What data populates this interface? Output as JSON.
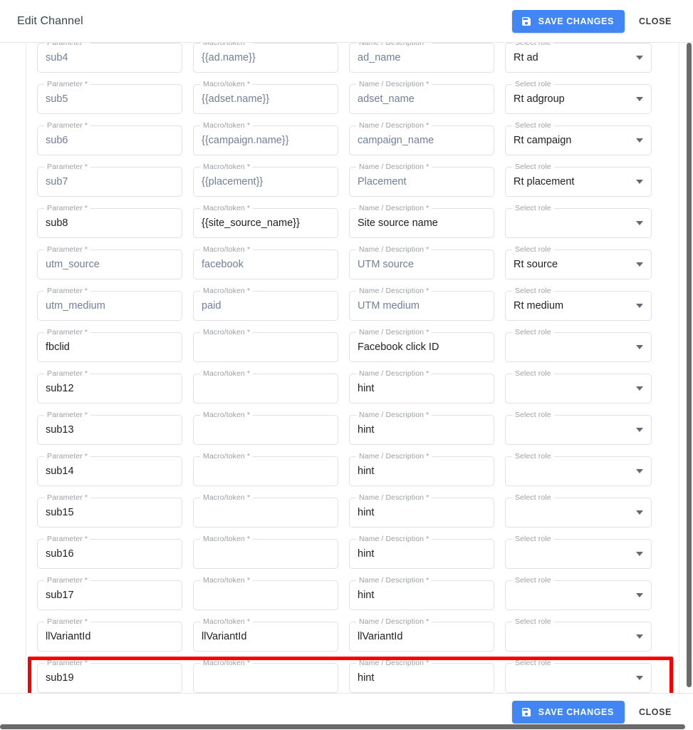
{
  "header": {
    "title": "Edit Channel",
    "save_label": "SAVE CHANGES",
    "close_label": "CLOSE",
    "save_icon": "save-floppy-icon",
    "accent_color": "#4285f4"
  },
  "footer": {
    "save_label": "SAVE CHANGES",
    "close_label": "CLOSE",
    "save_icon": "save-floppy-icon"
  },
  "columns": {
    "parameter": "Parameter *",
    "macro": "Macro/token *",
    "name": "Name / Description *",
    "role": "Select role"
  },
  "annotation": {
    "color": "#f80000",
    "target_row_index": 15
  },
  "rows": [
    {
      "parameter": "sub4",
      "parameter_filled": false,
      "macro": "{{ad.name}}",
      "macro_filled": false,
      "name": "ad_name",
      "name_filled": false,
      "role": "Rt ad",
      "role_filled": true
    },
    {
      "parameter": "sub5",
      "parameter_filled": false,
      "macro": "{{adset.name}}",
      "macro_filled": false,
      "name": "adset_name",
      "name_filled": false,
      "role": "Rt adgroup",
      "role_filled": true
    },
    {
      "parameter": "sub6",
      "parameter_filled": false,
      "macro": "{{campaign.name}}",
      "macro_filled": false,
      "name": "campaign_name",
      "name_filled": false,
      "role": "Rt campaign",
      "role_filled": true
    },
    {
      "parameter": "sub7",
      "parameter_filled": false,
      "macro": "{{placement}}",
      "macro_filled": false,
      "name": "Placement",
      "name_filled": false,
      "role": "Rt placement",
      "role_filled": true
    },
    {
      "parameter": "sub8",
      "parameter_filled": true,
      "macro": "{{site_source_name}}",
      "macro_filled": true,
      "name": "Site source name",
      "name_filled": true,
      "role": "",
      "role_filled": false
    },
    {
      "parameter": "utm_source",
      "parameter_filled": false,
      "macro": "facebook",
      "macro_filled": false,
      "name": "UTM source",
      "name_filled": false,
      "role": "Rt source",
      "role_filled": true
    },
    {
      "parameter": "utm_medium",
      "parameter_filled": false,
      "macro": "paid",
      "macro_filled": false,
      "name": "UTM medium",
      "name_filled": false,
      "role": "Rt medium",
      "role_filled": true
    },
    {
      "parameter": "fbclid",
      "parameter_filled": true,
      "macro": "",
      "macro_filled": false,
      "name": "Facebook click ID",
      "name_filled": true,
      "role": "",
      "role_filled": false
    },
    {
      "parameter": "sub12",
      "parameter_filled": true,
      "macro": "",
      "macro_filled": false,
      "name": "hint",
      "name_filled": true,
      "role": "",
      "role_filled": false
    },
    {
      "parameter": "sub13",
      "parameter_filled": true,
      "macro": "",
      "macro_filled": false,
      "name": "hint",
      "name_filled": true,
      "role": "",
      "role_filled": false
    },
    {
      "parameter": "sub14",
      "parameter_filled": true,
      "macro": "",
      "macro_filled": false,
      "name": "hint",
      "name_filled": true,
      "role": "",
      "role_filled": false
    },
    {
      "parameter": "sub15",
      "parameter_filled": true,
      "macro": "",
      "macro_filled": false,
      "name": "hint",
      "name_filled": true,
      "role": "",
      "role_filled": false
    },
    {
      "parameter": "sub16",
      "parameter_filled": true,
      "macro": "",
      "macro_filled": false,
      "name": "hint",
      "name_filled": true,
      "role": "",
      "role_filled": false
    },
    {
      "parameter": "sub17",
      "parameter_filled": true,
      "macro": "",
      "macro_filled": false,
      "name": "hint",
      "name_filled": true,
      "role": "",
      "role_filled": false
    },
    {
      "parameter": "llVariantId",
      "parameter_filled": true,
      "macro": "llVariantId",
      "macro_filled": true,
      "name": "llVariantId",
      "name_filled": true,
      "role": "",
      "role_filled": false
    },
    {
      "parameter": "sub19",
      "parameter_filled": true,
      "macro": "",
      "macro_filled": false,
      "name": "hint",
      "name_filled": true,
      "role": "",
      "role_filled": false
    }
  ]
}
